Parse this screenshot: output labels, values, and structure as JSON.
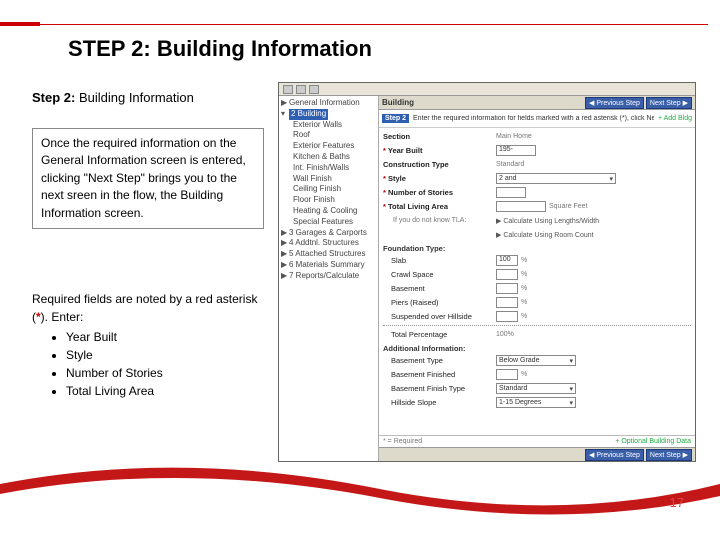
{
  "slide": {
    "title": "STEP 2:  Building Information",
    "subtitle_bold": "Step 2:",
    "subtitle_rest": "  Building Information",
    "para": "Once the required information on the General Information screen is entered, clicking \"Next Step\" brings you to the next sreen in the flow, the Building Information screen.",
    "required_intro_pre": "Required fields are noted by a red asterisk (",
    "required_intro_ast": "*",
    "required_intro_post": ").  Enter:",
    "bullets": [
      "Year Built",
      "Style",
      "Number of Stories",
      "Total Living Area"
    ],
    "pagenum": "17"
  },
  "shot": {
    "head": "Building",
    "btn_prev": "◀ Previous Step",
    "btn_next": "Next Step ▶",
    "step_badge": "Step 2",
    "step_text": "Enter the required information for fields marked with a red asterisk (*), click Next Step",
    "add_bldg": "+  Add Bldg",
    "tree": {
      "n1": "General Information",
      "n2": "2 Building",
      "leaves": [
        "Exterior Walls",
        "Roof",
        "Exterior Features",
        "Kitchen & Baths",
        "Int. Finish/Walls",
        "Wall Finish",
        "Ceiling Finish",
        "Floor Finish",
        "Heating & Cooling",
        "Special Features"
      ],
      "n3": "3 Garages & Carports",
      "n4": "4 Addtnl. Structures",
      "n5": "5 Attached Structures",
      "n6": "6 Materials Summary",
      "n7": "7 Reports/Calculate"
    },
    "form": {
      "section": "Section",
      "section_val": "Main Home",
      "year": "Year Built",
      "year_val": "195-",
      "construction": "Construction Type",
      "construction_val": "Standard",
      "style": "Style",
      "style_val": "2 and",
      "stories": "Number of Stories",
      "tla": "Total Living Area",
      "sqft": "Square Feet",
      "tla_hint": "If you do not know TLA:",
      "calc1": "▶ Calculate Using Lengths/Width",
      "calc2": "▶ Calculate Using Room Count",
      "found_h": "Foundation Type:",
      "slab": "Slab",
      "slab_v": "100",
      "crawl": "Crawl Space",
      "bsmt": "Basement",
      "piers": "Piers (Raised)",
      "susp": "Suspended over Hillside",
      "pct": "%",
      "total_pct_l": "Total Percentage",
      "total_pct_v": "100%",
      "addl_h": "Additional Information:",
      "bsmt_type": "Basement Type",
      "bsmt_type_v": "Below Grade",
      "bsmt_fin": "Basement Finished",
      "bsmt_fin_type": "Basement Finish Type",
      "bsmt_fin_type_v": "Standard",
      "hill": "Hillside Slope",
      "hill_v": "1-15 Degrees",
      "req_note": "* = Required",
      "opt_data": "+ Optional Building Data"
    }
  }
}
